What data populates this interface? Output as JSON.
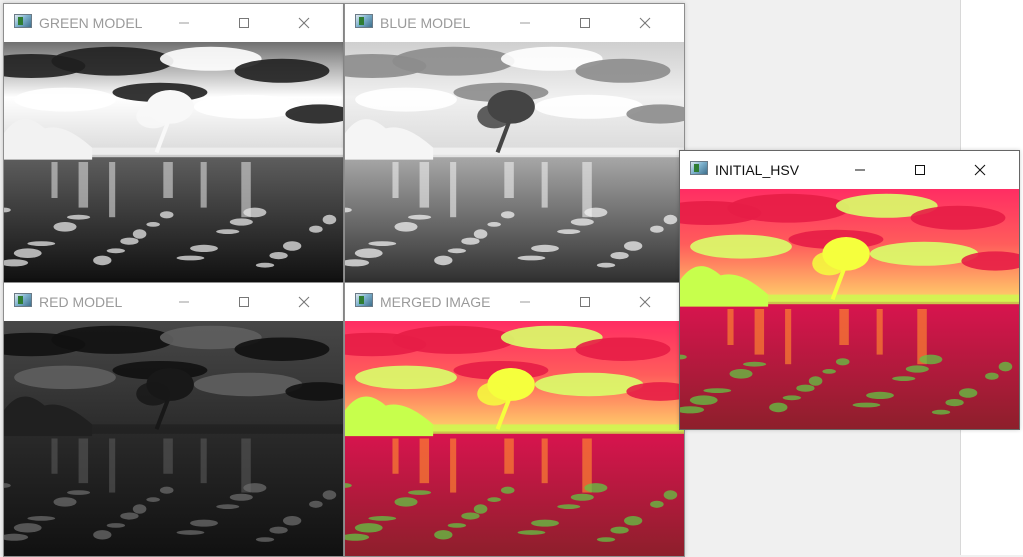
{
  "windows": [
    {
      "title": "GREEN MODEL",
      "view": "green-channel-image",
      "palette": {
        "sky_top": "#707070",
        "sky_mid": "#ffffff",
        "sky_bottom": "#d8d8d8",
        "cloud_light": "#ffffff",
        "cloud_dark": "#1f1f1f",
        "treeline": "#f2f2f2",
        "tree": "#f8f8f8",
        "water_top": "#5f5f5f",
        "water_bottom": "#101010",
        "reflection": "#cfcfcf",
        "rocks": "#e6e6e6"
      }
    },
    {
      "title": "BLUE MODEL",
      "view": "blue-channel-image",
      "palette": {
        "sky_top": "#cfcfcf",
        "sky_mid": "#f0f0f0",
        "sky_bottom": "#d9d9d9",
        "cloud_light": "#ffffff",
        "cloud_dark": "#8c8c8c",
        "treeline": "#f5f5f5",
        "tree": "#444444",
        "water_top": "#a9a9a9",
        "water_bottom": "#303030",
        "reflection": "#e8e8e8",
        "rocks": "#f0f0f0"
      }
    },
    {
      "title": "RED MODEL",
      "view": "red-channel-image",
      "palette": {
        "sky_top": "#474747",
        "sky_mid": "#3a3a3a",
        "sky_bottom": "#2a2a2a",
        "cloud_light": "#5f5f5f",
        "cloud_dark": "#111111",
        "treeline": "#202020",
        "tree": "#181818",
        "water_top": "#2a2a2a",
        "water_bottom": "#111111",
        "reflection": "#555555",
        "rocks": "#6b6b6b"
      }
    },
    {
      "title": "MERGED IMAGE",
      "view": "merged-hsv-image",
      "palette": {
        "sky_top": "#ff2d63",
        "sky_mid": "#ff5d5b",
        "sky_bottom": "#ffd86b",
        "cloud_light": "#d9ff6a",
        "cloud_dark": "#e71d46",
        "treeline": "#c7ff4c",
        "tree": "#f5ff3d",
        "water_top": "#d9144f",
        "water_bottom": "#8d1f2b",
        "reflection": "#ff8a30",
        "rocks": "#62c543"
      }
    },
    {
      "title": "INITIAL_HSV",
      "view": "initial-hsv-image",
      "palette": {
        "sky_top": "#ff2d63",
        "sky_mid": "#ff5d5b",
        "sky_bottom": "#ffd86b",
        "cloud_light": "#d9ff6a",
        "cloud_dark": "#e71d46",
        "treeline": "#c7ff4c",
        "tree": "#f5ff3d",
        "water_top": "#d9144f",
        "water_bottom": "#8d1f2b",
        "reflection": "#ff8a30",
        "rocks": "#62c543"
      }
    }
  ],
  "ui_colors": {
    "desktop": "#f0f0f0",
    "titlebar": "#ffffff",
    "inactive_title": "#9a9a9a",
    "active_title": "#111111"
  },
  "icons": {
    "app": "opencv-window-icon",
    "minimize": "minimize-icon",
    "maximize": "maximize-icon",
    "close": "close-icon"
  }
}
